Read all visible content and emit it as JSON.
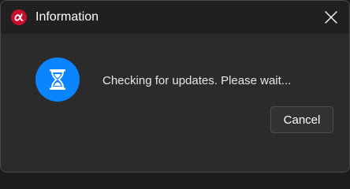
{
  "dialog": {
    "title": "Information",
    "message": "Checking for updates. Please wait...",
    "cancel_label": "Cancel"
  },
  "icons": {
    "app": "alpha-logo-icon",
    "close": "close-icon",
    "status": "hourglass-icon"
  },
  "colors": {
    "app_icon": "#c8102e",
    "status_icon": "#0a84ff",
    "window_bg": "#2b2b2b",
    "titlebar_bg": "#202020"
  }
}
